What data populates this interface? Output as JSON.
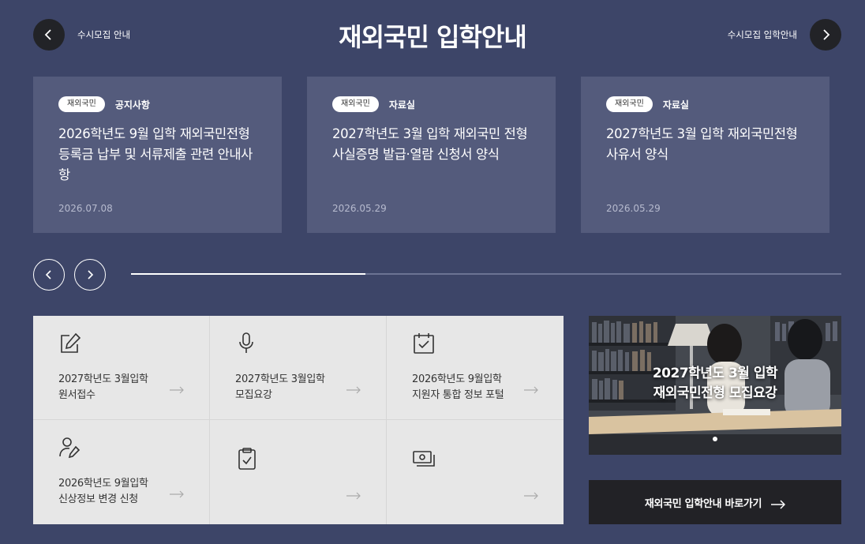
{
  "header": {
    "title": "재외국민 입학안내",
    "prev_label": "수시모집 안내",
    "next_label": "수시모집 입학안내",
    "prev_icon": "chevron-left-icon",
    "next_icon": "chevron-right-icon"
  },
  "notices": [
    {
      "tag": "재외국민",
      "category": "공지사항",
      "title": "2026학년도 9월 입학 재외국민전형 등록금 납부 및 서류제출 관련 안내사항",
      "date": "2026.07.08"
    },
    {
      "tag": "재외국민",
      "category": "자료실",
      "title": "2027학년도 3월 입학 재외국민 전형 사실증명 발급·열람 신청서 양식",
      "date": "2026.05.29"
    },
    {
      "tag": "재외국민",
      "category": "자료실",
      "title": "2027학년도 3월 입학 재외국민전형 사유서 양식",
      "date": "2026.05.29"
    }
  ],
  "slider": {
    "progress_fraction": 0.33,
    "prev_icon": "chevron-left-icon",
    "next_icon": "chevron-right-icon"
  },
  "quick_links": [
    {
      "icon": "edit-document-icon",
      "line1": "2027학년도 3월입학",
      "line2": "원서접수"
    },
    {
      "icon": "microphone-icon",
      "line1": "2027학년도 3월입학",
      "line2": "모집요강"
    },
    {
      "icon": "calendar-check-icon",
      "line1": "2026학년도 9월입학",
      "line2": "지원자 통합 정보 포털"
    },
    {
      "icon": "user-edit-icon",
      "line1": "2026학년도 9월입학",
      "line2": "신상정보 변경 신청"
    },
    {
      "icon": "clipboard-check-icon",
      "line1": "",
      "line2": ""
    },
    {
      "icon": "money-bill-icon",
      "line1": "",
      "line2": ""
    }
  ],
  "banner": {
    "line1": "2027학년도 3월 입학",
    "line2": "재외국민전형 모집요강"
  },
  "shortcut": {
    "label": "재외국민 입학안내 바로가기",
    "icon": "arrow-right-icon"
  },
  "colors": {
    "background": "#3d4568",
    "card": "#545b7c",
    "grid": "#e7e7e7",
    "button_dark": "#222226"
  }
}
